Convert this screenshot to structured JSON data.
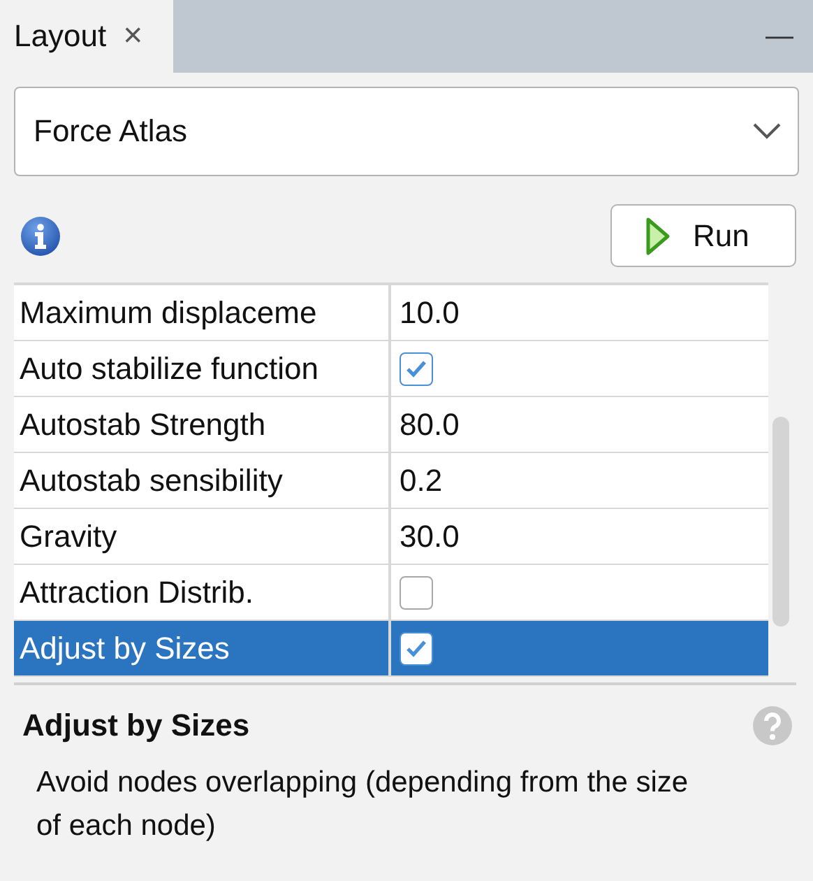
{
  "tab": {
    "label": "Layout",
    "close": "×"
  },
  "minimize": "—",
  "algorithm": {
    "value": "Force Atlas"
  },
  "run_button": {
    "label": "Run"
  },
  "properties": [
    {
      "kind": "value",
      "name": "Maximum displaceme",
      "value": "10.0",
      "selected": false
    },
    {
      "kind": "checkbox",
      "name": "Auto stabilize function",
      "checked": true,
      "selected": false
    },
    {
      "kind": "value",
      "name": "Autostab Strength",
      "value": "80.0",
      "selected": false
    },
    {
      "kind": "value",
      "name": "Autostab sensibility",
      "value": "0.2",
      "selected": false
    },
    {
      "kind": "value",
      "name": "Gravity",
      "value": "30.0",
      "selected": false
    },
    {
      "kind": "checkbox",
      "name": "Attraction Distrib.",
      "checked": false,
      "selected": false
    },
    {
      "kind": "checkbox",
      "name": "Adjust by Sizes",
      "checked": true,
      "selected": true
    }
  ],
  "description": {
    "title": "Adjust by Sizes",
    "text": "Avoid nodes overlapping (depending from the size of each node)"
  }
}
